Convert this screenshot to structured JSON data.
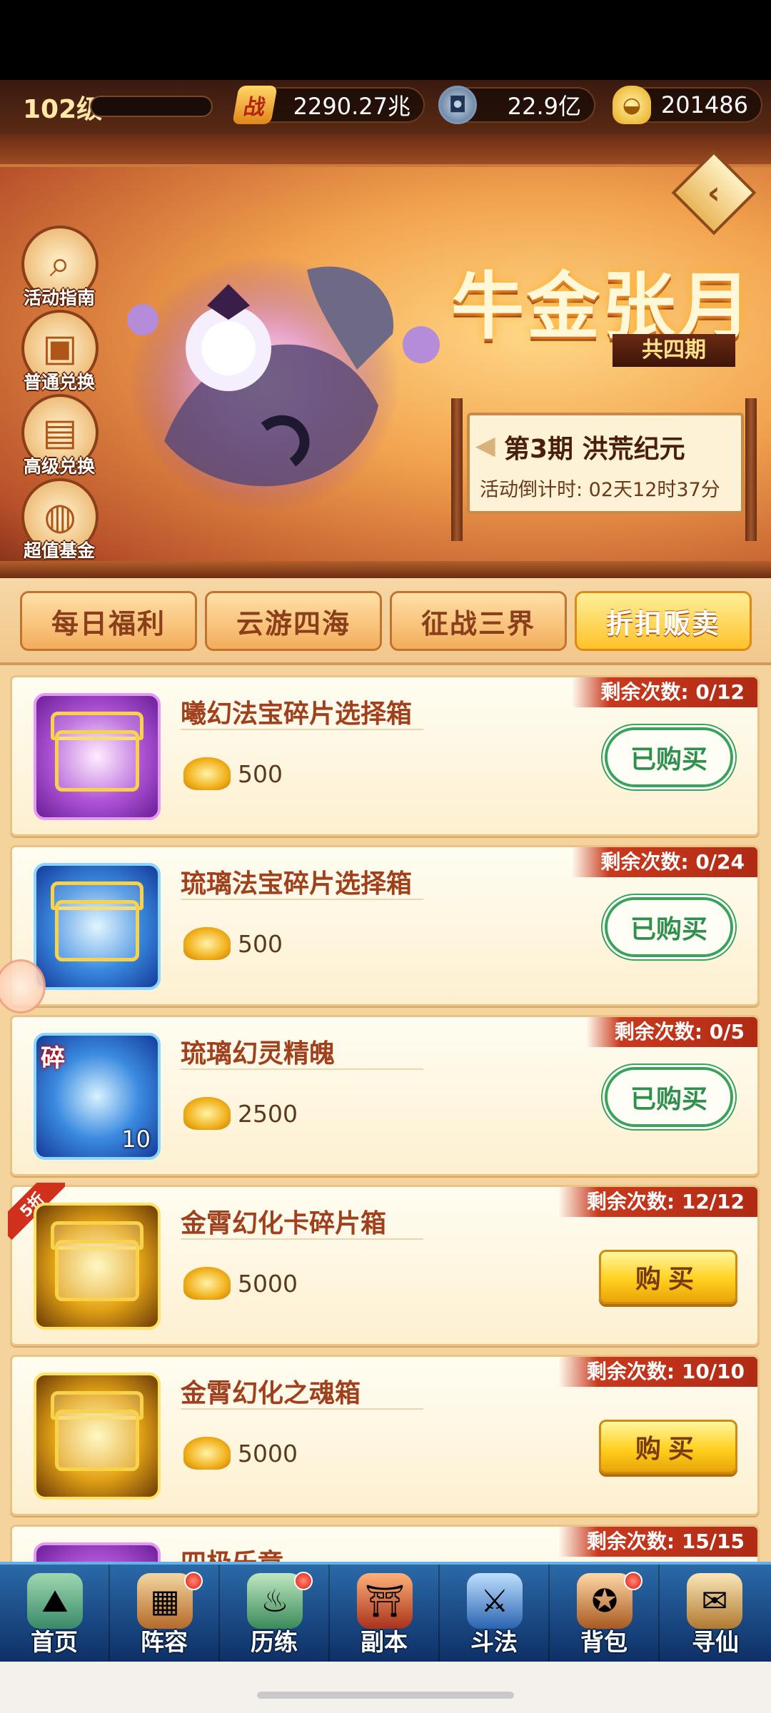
{
  "header": {
    "level": "102级",
    "power_icon_glyph": "战",
    "power": "2290.27兆",
    "coin": "22.9亿",
    "ingot": "201486"
  },
  "banner": {
    "title": "牛金张月",
    "period_count": "共四期",
    "phase": "第3期  洪荒纪元",
    "countdown": "活动倒计时: 02天12时37分",
    "side_buttons": [
      {
        "label": "活动指南",
        "icon": "magnifier-icon"
      },
      {
        "label": "普通兑换",
        "icon": "gift-box-icon"
      },
      {
        "label": "高级兑换",
        "icon": "gift-box-icon"
      },
      {
        "label": "超值基金",
        "icon": "treasure-pot-icon"
      }
    ]
  },
  "tabs": [
    {
      "label": "每日福利",
      "active": false
    },
    {
      "label": "云游四海",
      "active": false
    },
    {
      "label": "征战三界",
      "active": false
    },
    {
      "label": "折扣贩卖",
      "active": true
    }
  ],
  "items": [
    {
      "name": "曦幻法宝碎片选择箱",
      "price": "500",
      "remaining": "剩余次数: 0/12",
      "action": "已购买",
      "bought": true
    },
    {
      "name": "琉璃法宝碎片选择箱",
      "price": "500",
      "remaining": "剩余次数: 0/24",
      "action": "已购买",
      "bought": true
    },
    {
      "name": "琉璃幻灵精魄",
      "price": "2500",
      "remaining": "剩余次数: 0/5",
      "action": "已购买",
      "bought": true,
      "badge": "碎",
      "qty": "10"
    },
    {
      "name": "金霄幻化卡碎片箱",
      "price": "5000",
      "remaining": "剩余次数: 12/12",
      "action": "购买",
      "bought": false,
      "discount": "5折"
    },
    {
      "name": "金霄幻化之魂箱",
      "price": "5000",
      "remaining": "剩余次数: 10/10",
      "action": "购买",
      "bought": false
    },
    {
      "name": "四极乐章",
      "price": "",
      "remaining": "剩余次数: 15/15",
      "action": "",
      "bought": false
    }
  ],
  "nav": [
    {
      "label": "首页",
      "dot": false
    },
    {
      "label": "阵容",
      "dot": true
    },
    {
      "label": "历练",
      "dot": true
    },
    {
      "label": "副本",
      "dot": false
    },
    {
      "label": "斗法",
      "dot": false
    },
    {
      "label": "背包",
      "dot": true
    },
    {
      "label": "寻仙",
      "dot": false
    }
  ],
  "colors": {
    "accent": "#ffc22a",
    "bought_green": "#3aa35a",
    "remaining_red": "#c9391e",
    "nav_blue": "#0e2f66"
  }
}
